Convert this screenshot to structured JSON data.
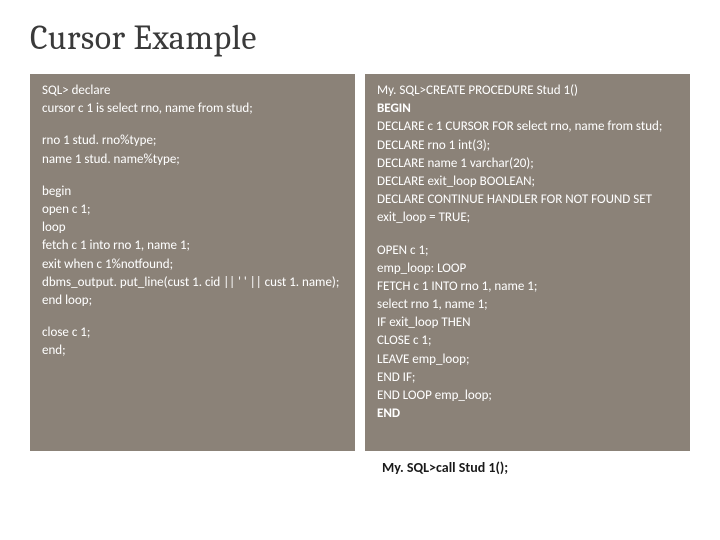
{
  "title": "Cursor Example",
  "left": {
    "l1": "SQL> declare",
    "l2": "cursor c 1 is select rno, name from stud;",
    "l3": "rno 1  stud. rno%type;",
    "l4": "name 1  stud. name%type;",
    "l5": "begin",
    "l6": "open c 1;",
    "l7": "loop",
    "l8": "fetch c 1 into rno 1, name 1;",
    "l9": "exit when c 1%notfound;",
    "l10": "dbms_output. put_line(cust 1. cid || ' ' || cust 1. name);",
    "l11": "end loop;",
    "l12": "close c 1;",
    "l13": "end;"
  },
  "right": {
    "r1": "My. SQL>CREATE PROCEDURE Stud 1()",
    "r2": " BEGIN",
    "r3": "  DECLARE c 1 CURSOR FOR select rno, name from stud;",
    "r4": "   DECLARE rno 1 int(3);",
    "r5": "   DECLARE name 1  varchar(20);",
    "r6": "   DECLARE exit_loop BOOLEAN;",
    "r7": "   DECLARE CONTINUE HANDLER FOR NOT FOUND SET exit_loop = TRUE;",
    "r8": "   OPEN c 1;",
    "r9": "   emp_loop: LOOP",
    "r10": "     FETCH  c 1 INTO rno 1, name 1;",
    "r11": "         select rno 1, name 1;",
    "r12": "        IF exit_loop THEN",
    "r13": "        CLOSE c 1;",
    "r14": "        LEAVE emp_loop;",
    "r15": "     END IF;",
    "r16": "   END LOOP emp_loop;",
    "r17": " END"
  },
  "footer": "My. SQL>call Stud 1();"
}
